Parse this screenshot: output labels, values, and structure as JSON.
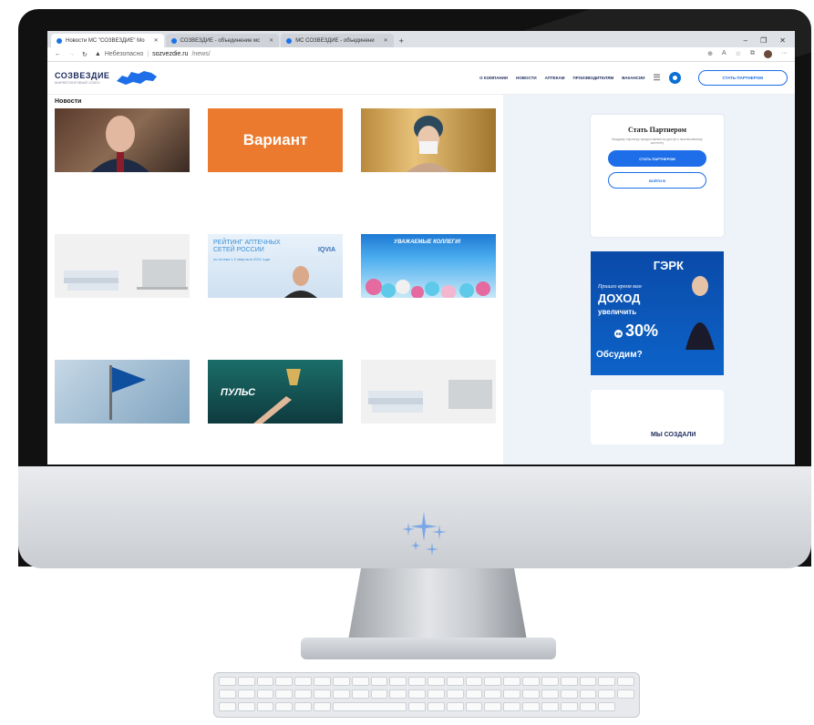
{
  "browser": {
    "tabs": [
      {
        "label": "Новости МС \"СОЗВЕЗДИЕ\" Мо",
        "active": true
      },
      {
        "label": "СОЗВЕЗДИЕ - объединение мс",
        "active": false
      },
      {
        "label": "МС СОЗВЕЗДИЕ - объединени",
        "active": false
      }
    ],
    "new_tab": "+",
    "window_controls": [
      "–",
      "❐",
      "✕"
    ],
    "address": {
      "security": "Небезопасно",
      "host": "sozvezdie.ru",
      "path": "/news/"
    }
  },
  "site": {
    "brand": "СОЗВЕЗДИЕ",
    "brand_sub": "МАРКЕТИНГОВЫЙ СОЮЗ",
    "nav": [
      "О КОМПАНИИ",
      "НОВОСТИ",
      "АПТЕКАМ",
      "ПРОИЗВОДИТЕЛЯМ",
      "ВАКАНСИИ"
    ],
    "cta": "СТАТЬ ПАРТНЕРОМ"
  },
  "news": {
    "title": "Новости",
    "variant_label": "Вариант",
    "card2_banner": {
      "line1": "РЕЙТИНГ АПТЕЧНЫХ",
      "line2": "СЕТЕЙ РОССИИ",
      "brand": "IQVIA",
      "sub": "по итогам 1-2 квартала 2021 года"
    },
    "card3_banner": {
      "headline": "УВАЖАЕМЫЕ КОЛЛЕГИ!"
    },
    "card8_logo": "ПУЛЬС"
  },
  "sidebar": {
    "partner_title": "Стать Партнером",
    "partner_text": "Каждому партнеру предоставляется доступ к эксклюзивному контенту",
    "partner_button": "СТАТЬ ПАРТНЕРОМ",
    "login_button": "ВОЙТИ В",
    "banner": {
      "brand": "ГЭРК",
      "line1": "Пришло время вам",
      "line2": "ДОХОД",
      "line3": "увеличить",
      "na": "на",
      "pct": "30%",
      "discuss": "Обсудим?"
    },
    "third_text": "МЫ СОЗДАЛИ"
  },
  "colors": {
    "accent": "#1d6ee8",
    "brand_navy": "#1d2b5c",
    "variant_orange": "#ec7a2e",
    "sidebar_bg": "#eef3fa"
  }
}
